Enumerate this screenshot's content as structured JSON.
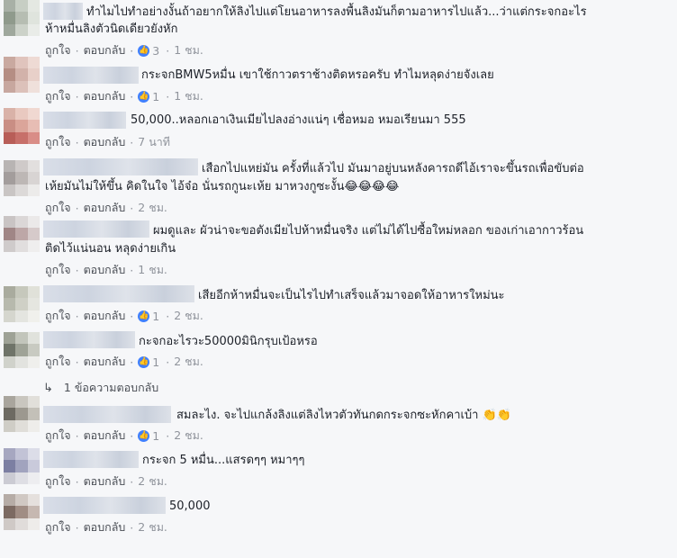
{
  "labels": {
    "like": "ถูกใจ",
    "reply": "ตอบกลับ",
    "sep": "·"
  },
  "comments": [
    {
      "text_lines": [
        "ทำไมไปทำอย่างงั้นถ้าอยากให้ลิงไปแต่โยนอาหารลงพื้นลิงมันก็ตามอาหารไปแล้ว...ว่าแต่กระจกอะไร",
        "ห้าหมื่นลิงตัวนิดเดียวยังหัก"
      ],
      "likes": "3",
      "time": "1 ชม."
    },
    {
      "text_lines": [
        "กระจกBMW5หมื่น เขาใช้กาวตราช้างติดหรอครับ ทำไมหลุดง่ายจังเลย"
      ],
      "likes": "1",
      "time": "1 ชม."
    },
    {
      "text_lines": [
        "50,000..หลอกเอาเงินเมียไปลงอ่างแน่ๆ เชื่อหมอ หมอเรียนมา 555"
      ],
      "likes": "",
      "time": "7 นาที"
    },
    {
      "text_lines": [
        "เสือกไปแหย่มัน ครั้งที่แล้วไป มันมาอยู่บนหลังคารถดีไอ้เราจะขึ้นรถเพื่อขับต่อ",
        "เห้ยมันไม่ให้ขึ้น คิดในใจ ไอ้จ๋อ นั่นรถกูนะเห้ย มาหวงกูซะงั้น😂😂😂😂"
      ],
      "likes": "",
      "time": "2 ชม."
    },
    {
      "text_lines": [
        "ผมดูและ ผัวน่าจะขอตังเมียไปห้าหมื่นจริง แต่ไม่ได้ไปซื้อใหม่หลอก ของเก่าเอากาวร้อน",
        "ติดไว้แน่นอน หลุดง่ายเกิน"
      ],
      "likes": "",
      "time": "1 ชม."
    },
    {
      "text_lines": [
        "เสียอีกห้าหมื่นจะเป็นไรไปทำเสร็จแล้วมาจอดให้อาหารใหม่นะ"
      ],
      "likes": "1",
      "time": "2 ชม."
    },
    {
      "text_lines": [
        "กะจกอะไรวะ50000มินิกรุบเป้อหรอ"
      ],
      "likes": "1",
      "time": "2 ชม."
    },
    {
      "text_lines": [
        "สมละไง. จะไปแกล้งลิงแต่ลิงไหวตัวทันกดกระจกซะหักคาเบ้า 👏👏"
      ],
      "likes": "1",
      "time": "2 ชม."
    },
    {
      "text_lines": [
        "กระจก 5 หมื่น...แสรดๆๆ หมาๆๆ"
      ],
      "likes": "",
      "time": "2 ชม."
    },
    {
      "text_lines": [
        "50,000"
      ],
      "likes": "",
      "time": "2 ชม."
    }
  ],
  "replies_link": "1 ข้อความตอบกลับ",
  "colors": {
    "background": "#f6f7f9",
    "link": "#4b4f56",
    "meta": "#90949c",
    "like_blue": "#4080ff"
  }
}
